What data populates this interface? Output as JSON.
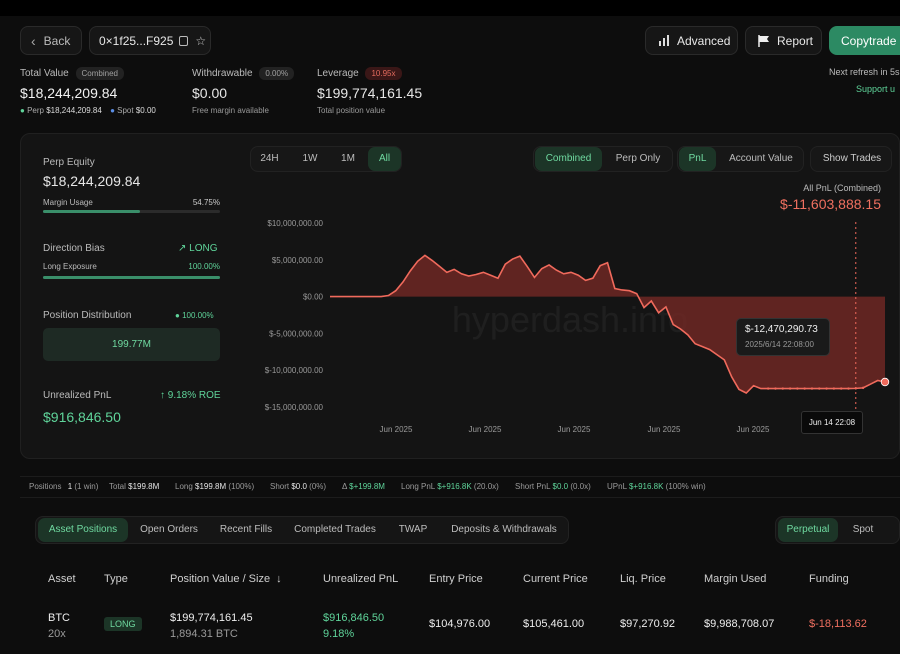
{
  "header": {
    "back_label": "Back",
    "address": "0×1f25...F925",
    "advanced_label": "Advanced",
    "report_label": "Report",
    "copytrade_label": "Copytrade",
    "next_refresh": "Next refresh in 5s",
    "support": "Support u"
  },
  "summary": {
    "total_value_label": "Total Value",
    "total_value_pill": "Combined",
    "total_value": "$18,244,209.84",
    "perp_label": "Perp",
    "perp_value": "$18,244,209.84",
    "spot_label": "Spot",
    "spot_value": "$0.00",
    "withdrawable_label": "Withdrawable",
    "withdrawable_pill": "0.00%",
    "withdrawable": "$0.00",
    "withdrawable_sub": "Free margin available",
    "leverage_label": "Leverage",
    "leverage_pill": "10.95x",
    "leverage_value": "$199,774,161.45",
    "leverage_sub": "Total position value"
  },
  "left_panel": {
    "perp_equity_label": "Perp Equity",
    "perp_equity": "$18,244,209.84",
    "margin_usage_label": "Margin Usage",
    "margin_usage": "54.75%",
    "margin_usage_fraction": 0.5475,
    "direction_bias_label": "Direction Bias",
    "direction_bias": "LONG",
    "long_exposure_label": "Long Exposure",
    "long_exposure": "100.00%",
    "long_exposure_fraction": 1.0,
    "position_distribution_label": "Position Distribution",
    "position_distribution_pct": "100.00%",
    "position_distribution_value": "199.77M",
    "unrealized_pnl_label": "Unrealized PnL",
    "roe": "9.18% ROE",
    "unrealized_pnl": "$916,846.50"
  },
  "chart_controls": {
    "ranges": [
      "24H",
      "1W",
      "1M",
      "All"
    ],
    "active_range": "All",
    "modes": [
      "Combined",
      "Perp Only"
    ],
    "active_mode": "Combined",
    "metrics": [
      "PnL",
      "Account Value"
    ],
    "active_metric": "PnL",
    "show_trades": "Show Trades"
  },
  "chart_header": {
    "label": "All PnL (Combined)",
    "value": "$-11,603,888.15"
  },
  "tooltip": {
    "value": "$-12,470,290.73",
    "date": "2025/6/14 22:08:00",
    "crosshair_label": "Jun 14 22:08"
  },
  "watermark": "hyperdash.info",
  "chart_data": {
    "type": "area",
    "title": "All PnL (Combined)",
    "ylabel": "",
    "xlabel": "",
    "ylim": [
      -15000000,
      10000000
    ],
    "y_ticks": [
      "$10,000,000.00",
      "$5,000,000.00",
      "$0.00",
      "$-5,000,000.00",
      "$-10,000,000.00",
      "$-15,000,000.00"
    ],
    "x_ticks": [
      "Jun 2025",
      "Jun 2025",
      "Jun 2025",
      "Jun 2025",
      "Jun 2025"
    ],
    "series": [
      {
        "values": [
          0,
          0,
          0,
          0,
          0,
          0,
          0,
          0,
          150000,
          800000,
          2000000,
          3500000,
          4800000,
          5600000,
          4900000,
          4100000,
          3300000,
          3700000,
          3100000,
          2800000,
          3000000,
          3300000,
          2900000,
          2500000,
          4400000,
          5100000,
          5500000,
          4100000,
          2600000,
          3800000,
          4300000,
          3600000,
          3100000,
          3300000,
          2900000,
          2200000,
          2500000,
          4200000,
          4600000,
          1100000,
          900000,
          800000,
          400000,
          -1500000,
          -600000,
          -2200000,
          -1400000,
          -3800000,
          -4400000,
          -5200000,
          -6400000,
          -6800000,
          -7200000,
          -7900000,
          -8600000,
          -10900000,
          -12600000,
          -13100000,
          -12100000,
          -12500000,
          -12500000,
          -12500000,
          -12500000,
          -12500000,
          -12500000,
          -12500000,
          -12500000,
          -12500000,
          -12500000,
          -12500000,
          -12500000,
          -12500000,
          -12470290.73,
          -12400000,
          -11900000,
          -11400000,
          -11603888.15
        ]
      }
    ],
    "grid": false,
    "legend": "none",
    "colors": {
      "line": "#f06a5c",
      "fill": "#7a2a26"
    }
  },
  "stats_bar": {
    "positions_label": "Positions",
    "positions_count": "1",
    "positions_win": "(1 win)",
    "total_label": "Total",
    "total": "$199.8M",
    "long_label": "Long",
    "long": "$199.8M",
    "long_pct": "(100%)",
    "short_label": "Short",
    "short": "$0.0",
    "short_pct": "(0%)",
    "delta_label": "Δ",
    "delta": "$+199.8M",
    "long_pnl_label": "Long PnL",
    "long_pnl": "$+916.8K",
    "long_pnl_x": "(20.0x)",
    "short_pnl_label": "Short PnL",
    "short_pnl": "$0.0",
    "short_pnl_x": "(0.0x)",
    "upnl_label": "UPnL",
    "upnl": "$+916.8K",
    "upnl_pct": "(100% win)"
  },
  "tabs": [
    "Asset Positions",
    "Open Orders",
    "Recent Fills",
    "Completed Trades",
    "TWAP",
    "Deposits & Withdrawals"
  ],
  "market_tabs": [
    "Perpetual",
    "Spot"
  ],
  "table": {
    "headers": [
      "Asset",
      "Type",
      "Position Value / Size",
      "Unrealized PnL",
      "Entry Price",
      "Current Price",
      "Liq. Price",
      "Margin Used",
      "Funding"
    ],
    "rows": [
      {
        "asset": "BTC",
        "leverage": "20x",
        "type": "LONG",
        "position_value": "$199,774,161.45",
        "size": "1,894.31 BTC",
        "unrealized_pnl": "$916,846.50",
        "unrealized_pct": "9.18%",
        "entry_price": "$104,976.00",
        "current_price": "$105,461.00",
        "liq_price": "$97,270.92",
        "margin_used": "$9,988,708.07",
        "funding": "$-18,113.62"
      }
    ]
  },
  "colors": {
    "accent": "#5fd49a",
    "negative": "#f07060",
    "background": "#0d0d0d"
  }
}
